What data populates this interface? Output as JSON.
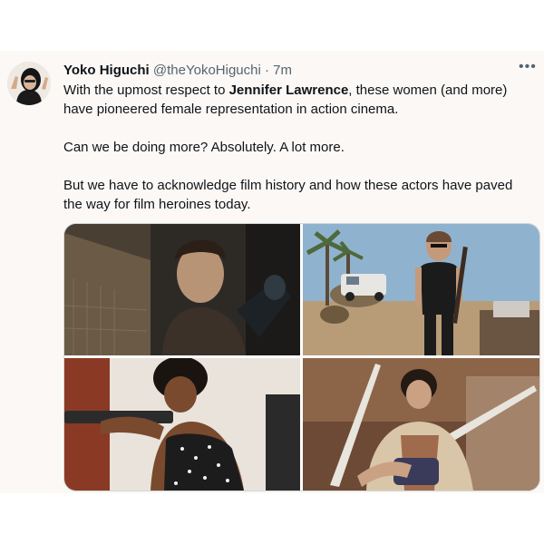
{
  "tweet": {
    "author_name": "Yoko Higuchi",
    "handle": "@theYokoHiguchi",
    "separator": "·",
    "timestamp": "7m",
    "more_label": "•••",
    "text_p1_before": "With the upmost respect to ",
    "text_p1_bold": "Jennifer Lawrence",
    "text_p1_after": ", these women (and more) have pioneered female representation in action cinema.",
    "text_p2": "Can we be doing more? Absolutely. A lot more.",
    "text_p3": "But we have to acknowledge film history and how these actors have paved the way for film heroines today."
  },
  "colors": {
    "background": "#fcf8f5",
    "text": "#0f1419",
    "secondary_text": "#536471"
  }
}
